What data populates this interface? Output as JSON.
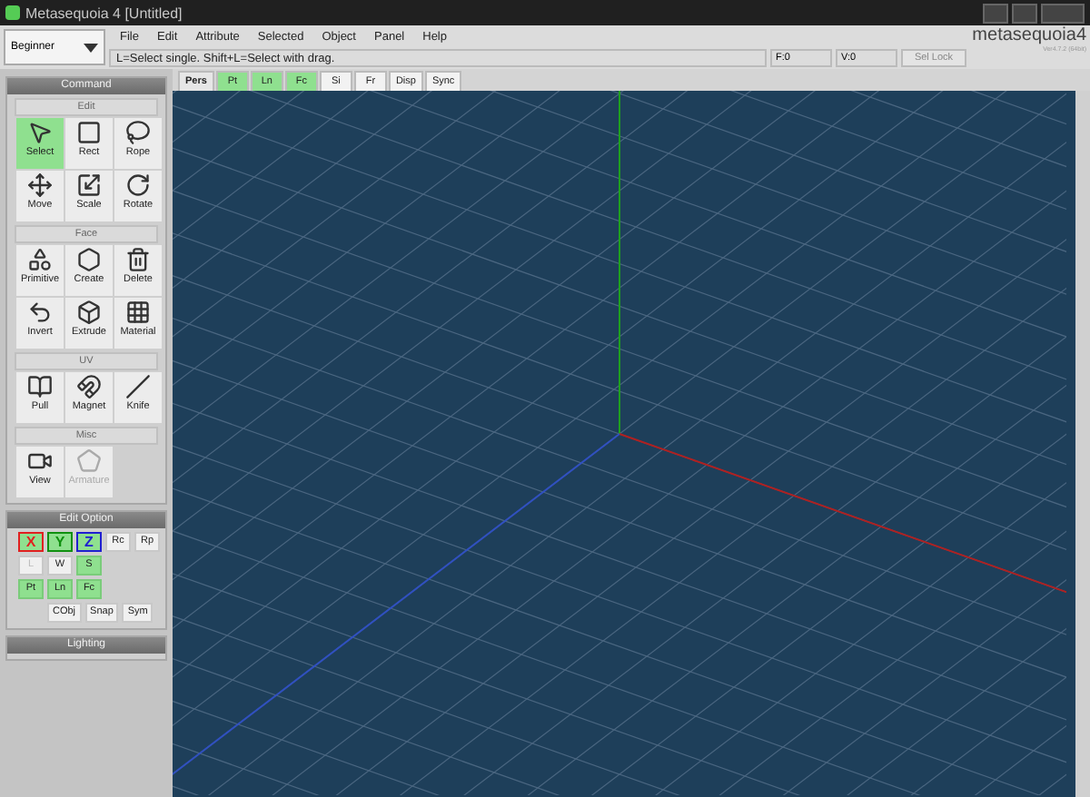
{
  "window": {
    "title": "Metasequoia 4 [Untitled]"
  },
  "mode_dropdown": {
    "value": "Beginner"
  },
  "menu": [
    "File",
    "Edit",
    "Attribute",
    "Selected",
    "Object",
    "Panel",
    "Help"
  ],
  "hint": "L=Select single.  Shift+L=Select with drag.",
  "counters": [
    {
      "label": "F:0"
    },
    {
      "label": "V:0"
    }
  ],
  "sel_lock": {
    "label": "Sel Lock",
    "selected": false
  },
  "logo": {
    "text": "metasequoia",
    "version_mark": "4",
    "version": "Ver4.7.2 (64bit)"
  },
  "view_tabs": [
    {
      "label": "Pers",
      "selected": false,
      "kind": "plain"
    },
    {
      "label": "Pt",
      "selected": true,
      "kind": "toggle"
    },
    {
      "label": "Ln",
      "selected": true,
      "kind": "toggle"
    },
    {
      "label": "Fc",
      "selected": true,
      "kind": "toggle"
    },
    {
      "label": "Si",
      "selected": false,
      "kind": "toggle"
    },
    {
      "label": "Fr",
      "selected": false,
      "kind": "toggle"
    },
    {
      "label": "Disp",
      "selected": false,
      "kind": "toggle"
    },
    {
      "label": "Sync",
      "selected": false,
      "kind": "toggle"
    }
  ],
  "command_panel": {
    "title": "Command",
    "sections": [
      {
        "title": "Edit",
        "tools": [
          {
            "label": "Select",
            "selected": true,
            "disabled": false
          },
          {
            "label": "Rect",
            "selected": false,
            "disabled": false
          },
          {
            "label": "Rope",
            "selected": false,
            "disabled": false
          },
          {
            "label": "Move",
            "selected": false,
            "disabled": false
          },
          {
            "label": "Scale",
            "selected": false,
            "disabled": false
          },
          {
            "label": "Rotate",
            "selected": false,
            "disabled": false
          }
        ]
      },
      {
        "title": "Face",
        "tools": [
          {
            "label": "Primitive",
            "selected": false,
            "disabled": false
          },
          {
            "label": "Create",
            "selected": false,
            "disabled": false
          },
          {
            "label": "Delete",
            "selected": false,
            "disabled": false
          },
          {
            "label": "Invert",
            "selected": false,
            "disabled": false
          },
          {
            "label": "Extrude",
            "selected": false,
            "disabled": false
          },
          {
            "label": "Material",
            "selected": false,
            "disabled": false
          }
        ]
      },
      {
        "title": "UV",
        "tools": [
          {
            "label": "Pull",
            "selected": false,
            "disabled": false
          },
          {
            "label": "Magnet",
            "selected": false,
            "disabled": false
          },
          {
            "label": "Knife",
            "selected": false,
            "disabled": false
          }
        ]
      },
      {
        "title": "Misc",
        "tools": [
          {
            "label": "View",
            "selected": false,
            "disabled": false
          },
          {
            "label": "Armature",
            "selected": false,
            "disabled": true
          }
        ]
      }
    ]
  },
  "edit_option": {
    "title": "Edit Option",
    "rows": [
      [
        {
          "label": "X",
          "selected": true,
          "disabled": false,
          "color": "#e02020"
        },
        {
          "label": "Y",
          "selected": true,
          "disabled": false,
          "color": "#109010"
        },
        {
          "label": "Z",
          "selected": true,
          "disabled": false,
          "color": "#2020d0"
        },
        {
          "label": "Rc",
          "selected": false,
          "disabled": false
        },
        {
          "label": "Rp",
          "selected": false,
          "disabled": false
        }
      ],
      [
        {
          "label": "L",
          "selected": false,
          "disabled": true
        },
        {
          "label": "W",
          "selected": false,
          "disabled": false
        },
        {
          "label": "S",
          "selected": true,
          "disabled": false
        }
      ],
      [
        {
          "label": "Pt",
          "selected": true,
          "disabled": false
        },
        {
          "label": "Ln",
          "selected": true,
          "disabled": false
        },
        {
          "label": "Fc",
          "selected": true,
          "disabled": false
        }
      ],
      [
        "",
        {
          "label": "CObj",
          "selected": false,
          "disabled": false
        },
        {
          "label": "Snap",
          "selected": false,
          "disabled": false
        },
        {
          "label": "Sym",
          "selected": false,
          "disabled": false
        }
      ]
    ]
  },
  "lighting": {
    "title": "Lighting"
  }
}
